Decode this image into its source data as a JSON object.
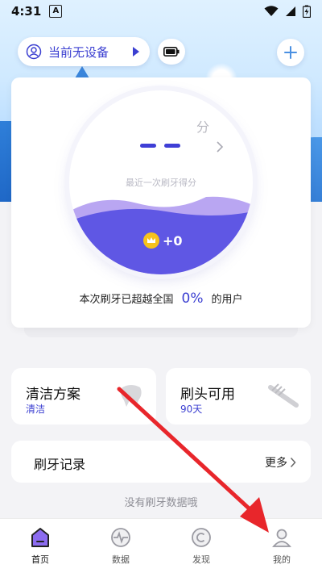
{
  "status_bar": {
    "time": "4:31",
    "notif_letter": "A"
  },
  "header": {
    "device_label": "当前无设备",
    "icons": [
      "user-circle-icon",
      "play-icon",
      "battery-icon",
      "plus-icon"
    ]
  },
  "score": {
    "value_placeholder": "- -",
    "unit": "分",
    "caption": "最近一次刷牙得分",
    "coins": "+0",
    "exceed_prefix": "本次刷牙已超越全国",
    "exceed_percent": "0%",
    "exceed_suffix": "的用户"
  },
  "cards": {
    "clean_plan": {
      "title": "清洁方案",
      "subtitle": "清洁"
    },
    "brush_head": {
      "title": "刷头可用",
      "subtitle": "90天"
    }
  },
  "records": {
    "title": "刷牙记录",
    "more": "更多",
    "empty": "没有刷牙数据哦"
  },
  "nav": {
    "items": [
      {
        "label": "首页",
        "icon": "home-icon",
        "active": true
      },
      {
        "label": "数据",
        "icon": "pulse-chart-icon",
        "active": false
      },
      {
        "label": "发现",
        "icon": "discover-icon",
        "active": false
      },
      {
        "label": "我的",
        "icon": "profile-icon",
        "active": false
      }
    ]
  },
  "colors": {
    "accent": "#3b3fd1",
    "wave_light": "#b9a6f2",
    "wave_dark": "#5a52e3",
    "annotation": "#e8262b"
  }
}
